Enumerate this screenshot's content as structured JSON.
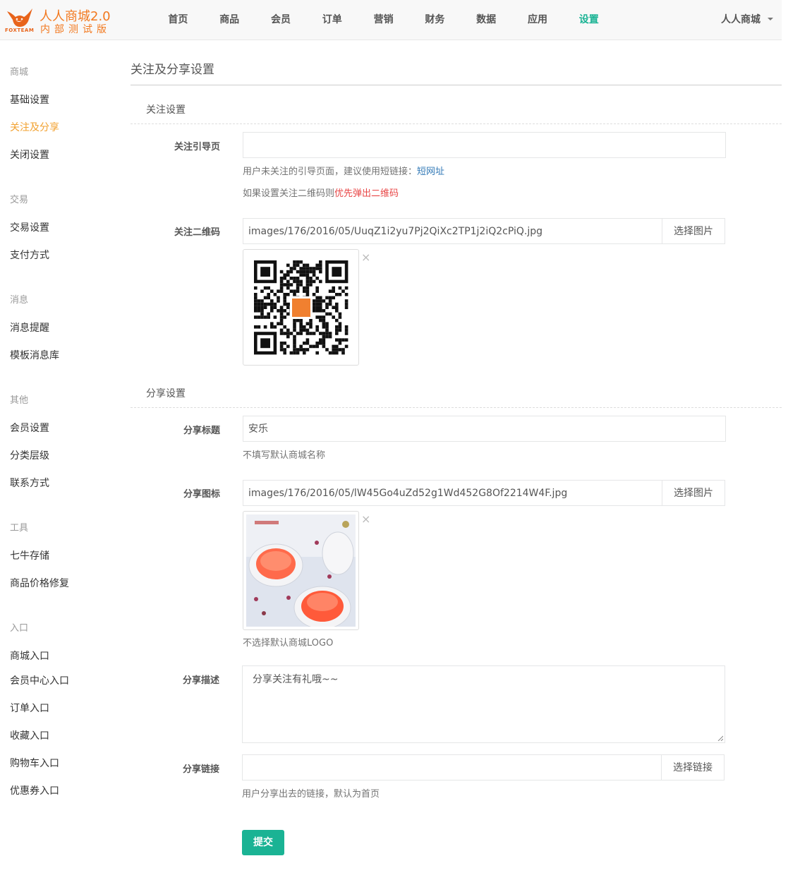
{
  "header": {
    "brand": "人人商城2.0",
    "subtitle": "内部测试版",
    "logo_text": "FOXTEAM",
    "nav": [
      "首页",
      "商品",
      "会员",
      "订单",
      "营销",
      "财务",
      "数据",
      "应用",
      "设置"
    ],
    "active_nav": "设置",
    "user": "人人商城",
    "accent": "#1ab394",
    "brand_color": "#f2791f"
  },
  "sidebar": {
    "groups": [
      {
        "title": "商城",
        "items": [
          "基础设置",
          "关注及分享",
          "关闭设置"
        ]
      },
      {
        "title": "交易",
        "items": [
          "交易设置",
          "支付方式"
        ]
      },
      {
        "title": "消息",
        "items": [
          "消息提醒",
          "模板消息库"
        ]
      },
      {
        "title": "其他",
        "items": [
          "会员设置",
          "分类层级",
          "联系方式"
        ]
      },
      {
        "title": "工具",
        "items": [
          "七牛存储",
          "商品价格修复"
        ]
      },
      {
        "title": "入口",
        "items": [
          "商城入口",
          "会员中心入口",
          "订单入口",
          "收藏入口",
          "购物车入口",
          "优惠券入口"
        ]
      }
    ],
    "active_item": "关注及分享",
    "active_color": "#f2a12f"
  },
  "page": {
    "title": "关注及分享设置",
    "follow_section": "关注设置",
    "share_section": "分享设置",
    "follow_guide": {
      "label": "关注引导页",
      "value": "",
      "help_prefix": "用户未关注的引导页面，建议使用短链接：",
      "help_link": "短网址",
      "help2_prefix": "如果设置关注二维码则",
      "help2_red": "优先弹出二维码"
    },
    "follow_qr": {
      "label": "关注二维码",
      "value": "images/176/2016/05/UuqZ1i2yu7Pj2QiXc2TP1j2iQ2cPiQ.jpg",
      "button": "选择图片",
      "remove": "×"
    },
    "share_title": {
      "label": "分享标题",
      "value": "安乐",
      "help": "不填写默认商城名称"
    },
    "share_icon": {
      "label": "分享图标",
      "value": "images/176/2016/05/lW45Go4uZd52g1Wd452G8Of2214W4F.jpg",
      "button": "选择图片",
      "remove": "×",
      "help": "不选择默认商城LOGO"
    },
    "share_desc": {
      "label": "分享描述",
      "value": "分享关注有礼哦~~"
    },
    "share_link": {
      "label": "分享链接",
      "value": "",
      "button": "选择链接",
      "help": "用户分享出去的链接，默认为首页"
    },
    "submit": "提交"
  }
}
